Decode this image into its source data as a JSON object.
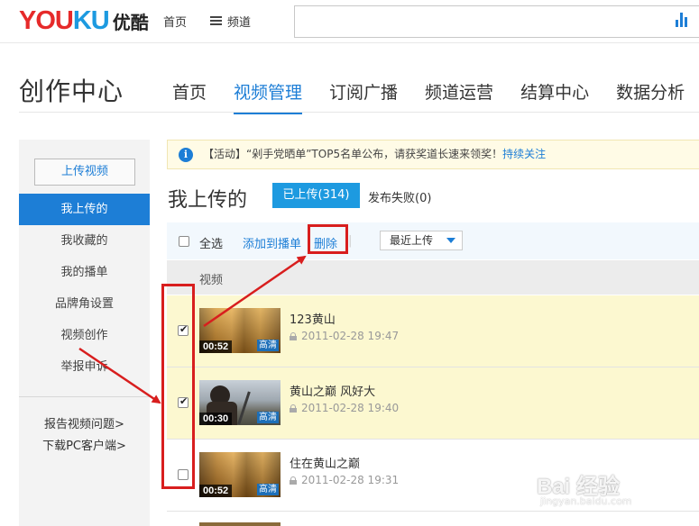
{
  "topbar": {
    "logo_en_a": "YOU",
    "logo_en_b": "KU",
    "logo_cn": "优酷",
    "home": "首页",
    "channel": "频道",
    "search_placeholder": ""
  },
  "center": {
    "title": "创作中心",
    "tabs": [
      "首页",
      "视频管理",
      "订阅广播",
      "频道运营",
      "结算中心",
      "数据分析"
    ],
    "active_tab": 1
  },
  "sidebar": {
    "upload_button": "上传视频",
    "items": [
      "我上传的",
      "我收藏的",
      "我的播单",
      "品牌角设置",
      "视频创作",
      "举报申诉"
    ],
    "active_item": 0,
    "links": [
      "报告视频问题>",
      "下载PC客户端>"
    ]
  },
  "notice": {
    "text": "【活动】“剁手党晒单”TOP5名单公布，请获奖道长速来领奖！",
    "link": "持续关注"
  },
  "uploads": {
    "title": "我上传的",
    "tab_uploaded": "已上传(314)",
    "tab_failed": "发布失败(0)"
  },
  "toolbar": {
    "select_all": "全选",
    "add_to_playlist": "添加到播单",
    "delete": "删除",
    "separator": "|",
    "sort": "最近上传"
  },
  "table": {
    "column_video": "视频",
    "rows": [
      {
        "title": "123黄山",
        "date": "2011-02-28 19:47",
        "duration": "00:52",
        "quality": "高清",
        "checked": true
      },
      {
        "title": "黄山之巅 风好大",
        "date": "2011-02-28 19:40",
        "duration": "00:30",
        "quality": "高清",
        "checked": true
      },
      {
        "title": "住在黄山之巅",
        "date": "2011-02-28 19:31",
        "duration": "00:52",
        "quality": "高清",
        "checked": false
      }
    ]
  },
  "watermark": {
    "main": "Bai 经验",
    "sub": "jingyan.baidu.com"
  },
  "colors": {
    "accent": "#1d7ed6",
    "logo_red": "#e62a2a",
    "logo_blue": "#1d9ae0",
    "annotation_red": "#d81e1e",
    "row_selected": "#fcf8d0"
  }
}
